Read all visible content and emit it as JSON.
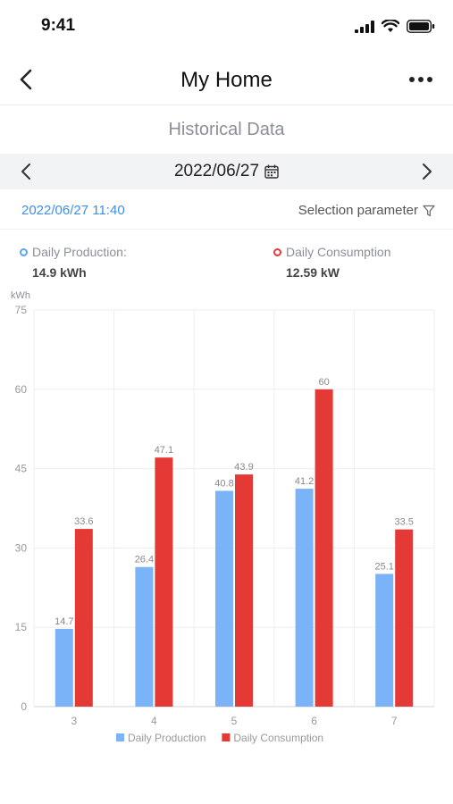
{
  "status": {
    "time": "9:41"
  },
  "nav": {
    "title": "My Home"
  },
  "section": {
    "title": "Historical Data"
  },
  "date_bar": {
    "date": "2022/06/27"
  },
  "meta": {
    "datetime": "2022/06/27 11:40",
    "filter_label": "Selection parameter"
  },
  "summary": {
    "production": {
      "label": "Daily Production:",
      "value": "14.9 kWh"
    },
    "consumption": {
      "label": "Daily Consumption",
      "value": "12.59 kW"
    }
  },
  "icons": {
    "back": "chevron-left-icon",
    "more": "more-horizontal-icon",
    "prev": "chevron-left-icon",
    "next": "chevron-right-icon",
    "calendar": "calendar-icon",
    "filter": "filter-icon",
    "signal": "signal-icon",
    "wifi": "wifi-icon",
    "battery": "battery-icon"
  },
  "colors": {
    "production": "#7ab3f7",
    "consumption": "#e53935",
    "accent": "#3d8fe6"
  },
  "chart_data": {
    "type": "bar",
    "ylabel": "kWh",
    "ylim": [
      0,
      75
    ],
    "yticks": [
      0,
      15,
      30,
      45,
      60,
      75
    ],
    "categories": [
      "3",
      "4",
      "5",
      "6",
      "7"
    ],
    "grid": true,
    "legend_position": "bottom",
    "series": [
      {
        "name": "Daily Production",
        "values": [
          14.7,
          26.4,
          40.8,
          41.2,
          25.1
        ],
        "color": "#7ab3f7"
      },
      {
        "name": "Daily Consumption",
        "values": [
          33.6,
          47.1,
          43.9,
          60,
          33.5
        ],
        "color": "#e53935"
      }
    ]
  }
}
